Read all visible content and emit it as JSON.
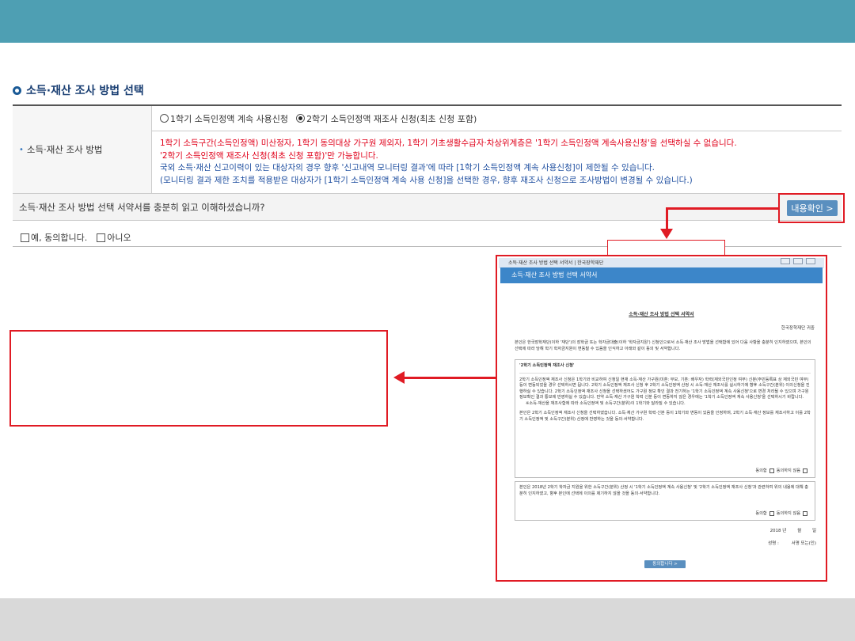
{
  "section": {
    "title": "소득·재산 조사 방법 선택"
  },
  "row1": {
    "label": "소득·재산 조사 방법",
    "option1": "1학기 소득인정액 계속 사용신청",
    "option2": "2학기 소득인정액 재조사 신청(최초 신청 포함)",
    "selected": "option2",
    "note_red_1": "1학기 소득구간(소득인정액) 미산정자, 1학기 동의대상 가구원 제외자, 1학기 기초생활수급자·차상위계층은 '1학기 소득인정액 계속사용신청'을 선택하실 수 없습니다.",
    "note_red_2": "'2학기 소득인정액 재조사 신청(최초 신청 포함)'만 가능합니다.",
    "note_blue_1": "국외 소득·재산 신고이력이 있는 대상자의 경우 향후 '신고내역 모니터링 결과'에 따라 [1학기 소득인정액 계속 사용신청]이 제한될 수 있습니다.",
    "note_blue_2": "(모니터링 결과 제한 조치를 적용받은 대상자가 [1학기 소득인정액 계속 사용 신청]을 선택한 경우, 향후 재조사 신청으로 조사방법이 변경될 수 있습니다.)"
  },
  "row2": {
    "question": "소득·재산 조사 방법 선택 서약서를 충분히 읽고 이해하셨습니까?",
    "confirm_label": "내용확인 >"
  },
  "agree": {
    "yes": "예, 동의합니다.",
    "no": "아니오"
  },
  "popup": {
    "window_title": "소득·재산 조사 방법 선택 서약서 | 한국장학재단",
    "header": "소득·재산 조사 방법 선택 서약서",
    "doc_title": "소득·재산 조사 방법 선택 서약서",
    "org": "한국장학재단 귀중",
    "intro": "본인은 한국장학재단(이하 '재단')의 장학금 또는 학자금대출(이하 '학자금지원') 신청인으로서 소득·재산 조사 방법을 선택함에 있어 다음 사항을 충분히 인지하였으며, 본인의 선택에 따라 당해 학기 학자금지원이 변동될 수 있음을 인식하고 아래와 같이 동의 및 서약합니다.",
    "box1_heading": "'2학기 소득인정액 재조사 신청'",
    "box1_text": "2학기 소득인정액 재조사 신청은 1학기와 비교하여 신청일 현재 소득·재산 가구원(미혼: 부모, 기혼: 배우자) 학력(재외국민인정 여부) 신분(주민등록표 상 재외국민 여부) 등이 변동되었을 경우 선택하시면 됩니다. 2학기 소득인정액 재조사 신청 후 2학기 소득인정액 산정 시 소득·재산 재조사를 실시하기에 향후 소득구간(분위) 이의신청을 진행하실 수 있습니다. 2학기 소득인정액 재조사 신청을 선택하셨어도 가구원 정보 확인 결과 전기하는 '1학기 소득인정액 계속 사용신청'으로 변경 처리될 수 있으며 가구원 정보확인 결과 통보에 반영하실 수 있습니다. 만약 소득·재산 가구원 학력 신분 등이 변동하지 않은 경우에는 '1학기 소득인정액 계속 사용신청'을 선택하시기 바랍니다.",
    "box1_note": "※소득·재산을 재조사함에 따라 소득인정액 및 소득구간(분위)이 1학기와 달라질 수 있습니다.",
    "box1_consent": "본인은 2학기 소득인정액 재조사 신청을 선택하였습니다. 소득·재산 가구원 학력·신분 등이 1학기와 변동이 있음을 인정하며, 2학기 소득·재산 정보를 재조사하고 이를 2학기 소득인정액 및 소득구간(분위) 산정에 반영하는 것을 동의·서약합니다.",
    "box2_text": "본인은 2018년 2학기 학자금 지원을 위한 소득구간(분위) 산정 시 '1학기 소득인정액 계속 사용신청' 및 '2학기 소득인정액 재조사 신청'과 관련하여 위의 내용에 대해 충분히 인지하였고, 향후 본인에 선택에 이의를 제기하지 않을 것을 동의·서약합니다.",
    "agree_label": "동의함",
    "disagree_label": "동의하지 않음",
    "date_year": "2018 년",
    "date_month": "월",
    "date_day": "일",
    "sign_label": "성명 :",
    "sign_value": "서명 또는(인)",
    "button": "동의합니다 >"
  }
}
